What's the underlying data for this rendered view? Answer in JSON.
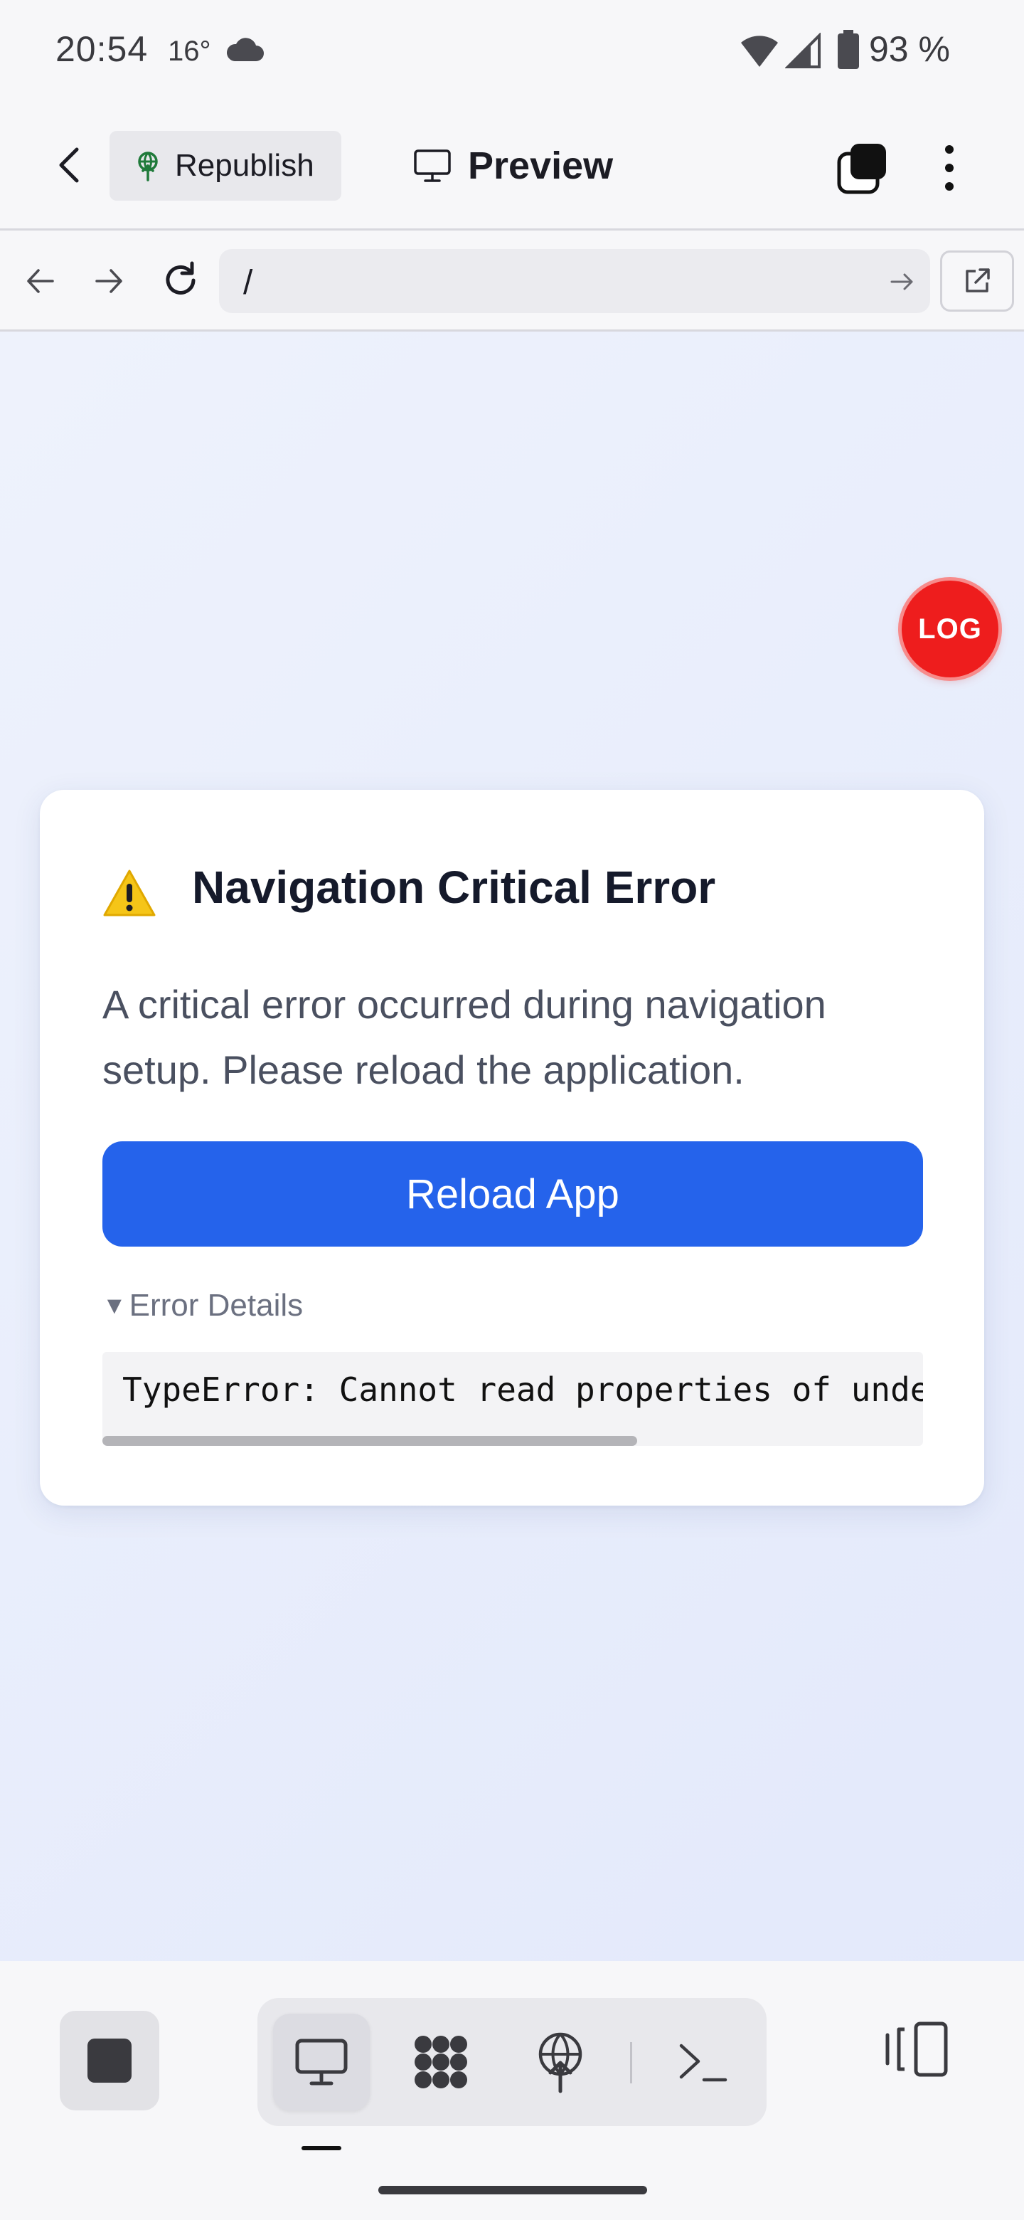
{
  "status_bar": {
    "time": "20:54",
    "temperature": "16°",
    "battery": "93 %",
    "icons": [
      "cloud-icon",
      "wifi-icon",
      "signal-icon",
      "battery-icon"
    ]
  },
  "toolbar": {
    "republish_label": "Republish",
    "preview_label": "Preview",
    "icons": [
      "back-arrow-icon",
      "republish-icon",
      "monitor-icon",
      "tabs-icon",
      "more-vertical-icon"
    ]
  },
  "browser": {
    "url": "/",
    "icons": [
      "back-icon",
      "forward-icon",
      "reload-icon",
      "go-arrow-icon",
      "open-external-icon"
    ]
  },
  "page": {
    "log_button_label": "LOG",
    "error": {
      "title": "Navigation Critical Error",
      "message": "A critical error occurred during navigation setup. Please reload the application.",
      "reload_label": "Reload App",
      "details_label": "Error Details",
      "details_code": "TypeError: Cannot read properties of unde"
    }
  },
  "bottom_bar": {
    "icons": [
      "stop-icon",
      "desktop-icon",
      "network-icon",
      "deploy-icon",
      "terminal-icon",
      "split-view-icon"
    ],
    "active_mode": "desktop"
  },
  "colors": {
    "accent": "#2563eb",
    "log_red": "#ee1d1d",
    "background_gradient": [
      "#eef2fc",
      "#e3e9fb"
    ]
  }
}
